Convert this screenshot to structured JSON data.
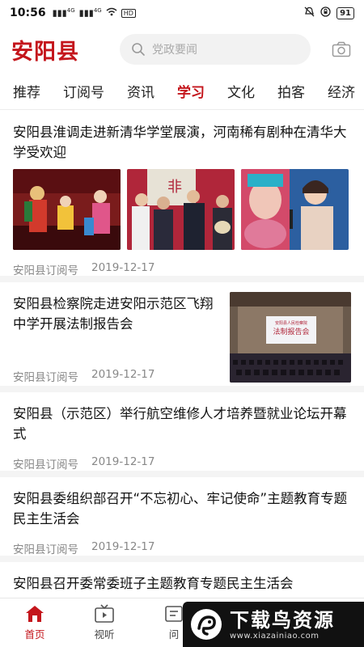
{
  "status_bar": {
    "time": "10:56",
    "signal_1": "4G",
    "signal_2": "4G",
    "hd_label": "HD",
    "battery": "91"
  },
  "header": {
    "logo": "安阳县",
    "search_placeholder": "党政要闻",
    "camera_icon": "camera-icon"
  },
  "tabs": [
    {
      "label": "推荐",
      "active": false
    },
    {
      "label": "订阅号",
      "active": false
    },
    {
      "label": "资讯",
      "active": false
    },
    {
      "label": "学习",
      "active": true
    },
    {
      "label": "文化",
      "active": false
    },
    {
      "label": "拍客",
      "active": false
    },
    {
      "label": "经济",
      "active": false
    }
  ],
  "articles": [
    {
      "title": "安阳县淮调走进新清华学堂展演，河南稀有剧种在清华大学受欢迎",
      "source": "安阳县订阅号",
      "date": "2019-12-17"
    },
    {
      "title": "安阳县检察院走进安阳示范区飞翔中学开展法制报告会",
      "source": "安阳县订阅号",
      "date": "2019-12-17",
      "image_caption": "法制报告会",
      "image_subtitle": "安阳县人民检察院"
    },
    {
      "title": "安阳县（示范区）举行航空维修人才培养暨就业论坛开幕式",
      "source": "安阳县订阅号",
      "date": "2019-12-17"
    },
    {
      "title": "安阳县委组织部召开“不忘初心、牢记使命”主题教育专题民主生活会",
      "source": "安阳县订阅号",
      "date": "2019-12-17"
    },
    {
      "title": "安阳县召开委常委班子主题教育专题民主生活会"
    }
  ],
  "bottom_nav": [
    {
      "label": "首页",
      "icon": "home-icon",
      "active": true
    },
    {
      "label": "视听",
      "icon": "tv-icon",
      "active": false
    },
    {
      "label": "问",
      "icon": "ask-icon",
      "active": false
    }
  ],
  "watermark": {
    "main": "下载鸟资源",
    "url": "www.xiazainiao.com"
  },
  "colors": {
    "brand_red": "#c4161c",
    "meta_gray": "#888888"
  }
}
